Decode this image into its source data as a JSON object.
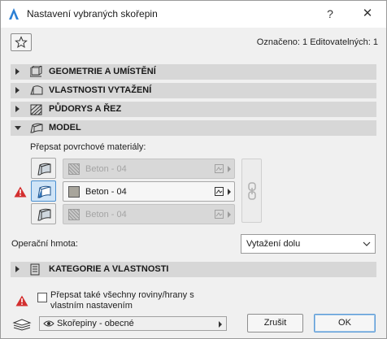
{
  "window": {
    "title": "Nastavení vybraných skořepin",
    "help_label": "?",
    "close_label": "✕"
  },
  "selection_info": "Označeno: 1 Editovatelných: 1",
  "sections": [
    {
      "label": "GEOMETRIE A UMÍSTĚNÍ",
      "icon": "geometry-icon",
      "expanded": false
    },
    {
      "label": "VLASTNOSTI VYTAŽENÍ",
      "icon": "extrusion-icon",
      "expanded": false
    },
    {
      "label": "PŮDORYS A ŘEZ",
      "icon": "floorplan-icon",
      "expanded": false
    },
    {
      "label": "MODEL",
      "icon": "model-icon",
      "expanded": true
    }
  ],
  "model": {
    "override_label": "Přepsat povrchové materiály:",
    "materials": [
      {
        "name": "Beton - 04",
        "enabled": false
      },
      {
        "name": "Beton - 04",
        "enabled": true
      },
      {
        "name": "Beton - 04",
        "enabled": false
      }
    ],
    "operation_label": "Operační hmota:",
    "operation_value": "Vytažení dolu"
  },
  "category_section": {
    "label": "KATEGORIE A VLASTNOSTI",
    "icon": "list-icon",
    "expanded": false
  },
  "override_planes": {
    "label": "Přepsat také všechny roviny/hrany s vlastním nastavením",
    "checked": false
  },
  "footer": {
    "view_select": "Skořepiny - obecné",
    "cancel_label": "Zrušit",
    "ok_label": "OK"
  },
  "colors": {
    "section_bg": "#d7d7d7",
    "accent": "#4a8fd0",
    "warning": "#d32f2f"
  }
}
